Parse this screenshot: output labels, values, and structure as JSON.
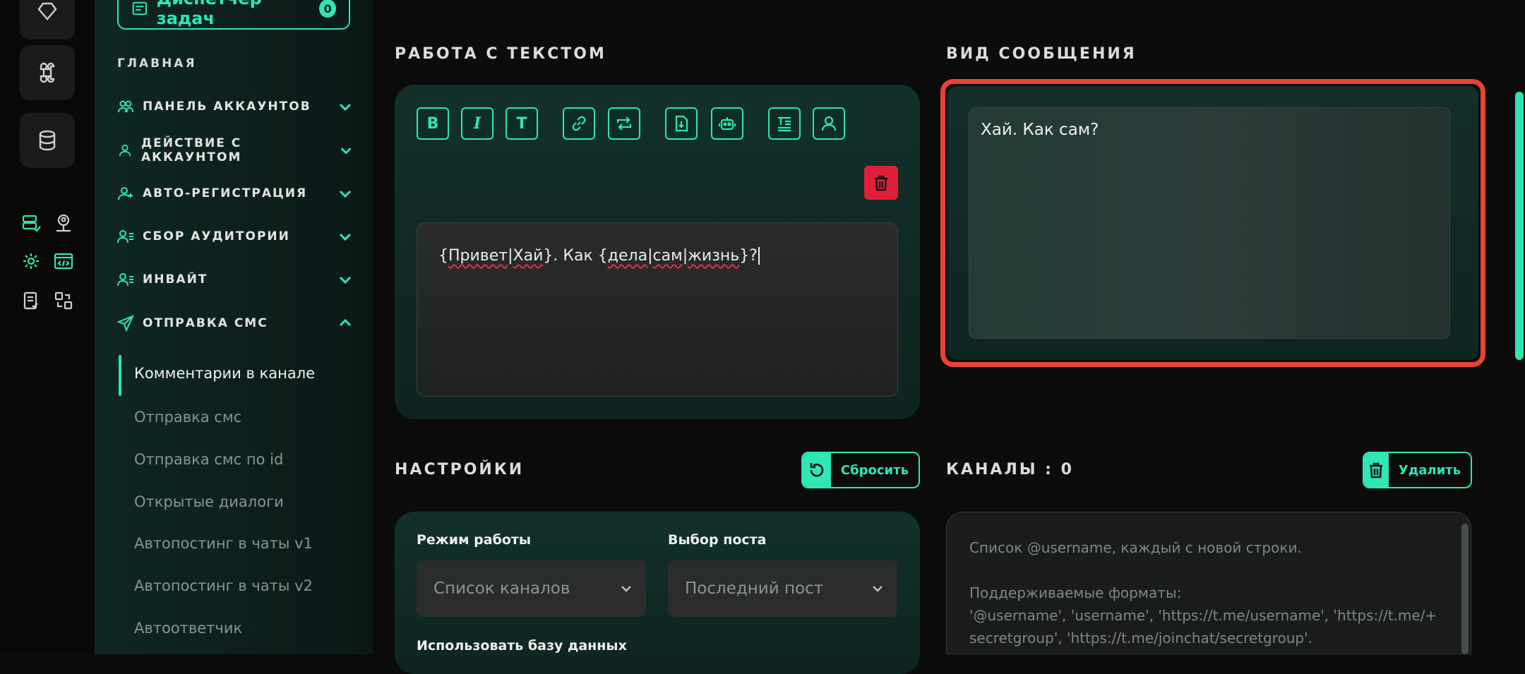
{
  "sidebar": {
    "task_manager": {
      "label": "Диспетчер задач",
      "count": "0"
    },
    "heading": "ГЛАВНАЯ",
    "menu": [
      {
        "label": "ПАНЕЛЬ АККАУНТОВ",
        "icon": "users-icon"
      },
      {
        "label": "ДЕЙСТВИЕ С АККАУНТОМ",
        "icon": "user-icon"
      },
      {
        "label": "АВТО-РЕГИСТРАЦИЯ",
        "icon": "user-plus-icon"
      },
      {
        "label": "СБОР АУДИТОРИИ",
        "icon": "user-list-icon"
      },
      {
        "label": "ИНВАЙТ",
        "icon": "user-list-icon"
      },
      {
        "label": "ОТПРАВКА СМС",
        "icon": "send-icon"
      }
    ],
    "sub_items": [
      "Комментарии в канале",
      "Отправка смс",
      "Отправка смс по id",
      "Открытые диалоги",
      "Автопостинг в чаты v1",
      "Автопостинг в чаты v2",
      "Автоответчик"
    ],
    "active_sub_item": "Комментарии в канале"
  },
  "text_section": {
    "title": "РАБОТА С ТЕКСТОМ",
    "toolbar": [
      "B",
      "I",
      "T"
    ],
    "editor_value_parts": [
      "{",
      "Привет",
      "|",
      "Хай",
      "}. Как {",
      "дела",
      "|",
      "сам",
      "|",
      "жизнь",
      "}?"
    ]
  },
  "preview_section": {
    "title": "ВИД СООБЩЕНИЯ",
    "message": "Хай. Как сам?"
  },
  "settings_section": {
    "title": "НАСТРОЙКИ",
    "reset_label": "Сбросить",
    "mode_label": "Режим работы",
    "mode_value": "Список каналов",
    "post_label": "Выбор поста",
    "post_value": "Последний пост",
    "db_label": "Использовать базу данных"
  },
  "channels_section": {
    "title": "КАНАЛЫ : 0",
    "delete_label": "Удалить",
    "placeholder_line1": "Список @username, каждый с новой строки.",
    "placeholder_line2": "Поддерживаемые форматы:",
    "placeholder_line3": "'@username', 'username', 'https://t.me/username', 'https://t.me/+",
    "placeholder_line4": "secretgroup', 'https://t.me/joinchat/secretgroup'."
  },
  "colors": {
    "accent": "#2ee6b6",
    "danger": "#e0203a",
    "highlight": "#e84333"
  }
}
